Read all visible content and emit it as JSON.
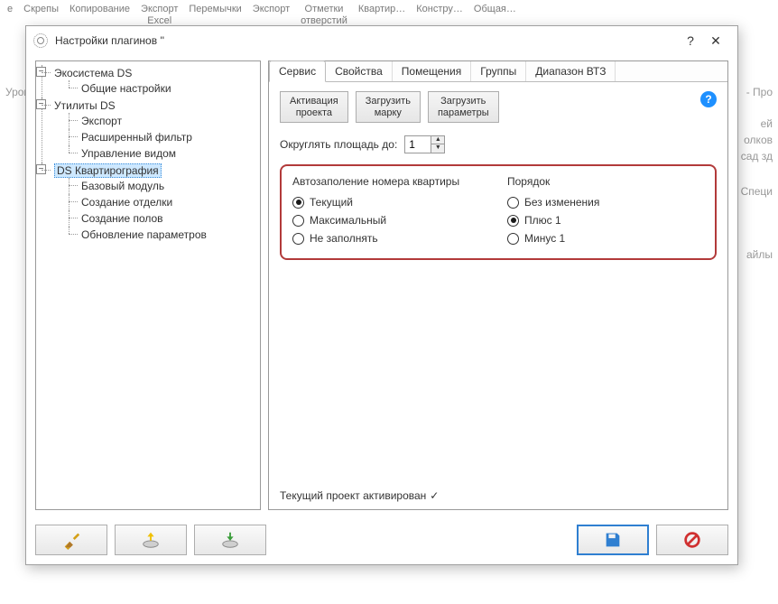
{
  "ribbon": {
    "items": [
      "е",
      "Скрепы",
      "Копирование",
      "Экспорт\nExcel",
      "Перемычки",
      "Экспорт",
      "Отметки\nотверстий",
      "Квартир…",
      "Констру…",
      "Общая…"
    ]
  },
  "bg": {
    "left": "Урове",
    "right_lines": [
      "- Про",
      "ей",
      "олков",
      "сад зд",
      "Специ",
      "айлы"
    ]
  },
  "dialog": {
    "title": "Настройки плагинов ''"
  },
  "tree": {
    "n0": "Экосистема DS",
    "n0_0": "Общие настройки",
    "n1": "Утилиты DS",
    "n1_0": "Экспорт",
    "n1_1": "Расширенный фильтр",
    "n1_2": "Управление видом",
    "n2": "DS Квартирография",
    "n2_0": "Базовый модуль",
    "n2_1": "Создание отделки",
    "n2_2": "Создание полов",
    "n2_3": "Обновление параметров"
  },
  "tabs": {
    "t0": "Сервис",
    "t1": "Свойства",
    "t2": "Помещения",
    "t3": "Группы",
    "t4": "Диапазон ВТЗ"
  },
  "buttons": {
    "activate": "Активация\nпроекта",
    "load_mark": "Загрузить\nмарку",
    "load_params": "Загрузить\nпараметры"
  },
  "round": {
    "label": "Округлять площадь до:",
    "value": "1"
  },
  "group": {
    "auto_title": "Автозаполение номера квартиры",
    "order_title": "Порядок",
    "auto": {
      "current": "Текущий",
      "max": "Максимальный",
      "none": "Не заполнять"
    },
    "order": {
      "keep": "Без изменения",
      "plus1": "Плюс 1",
      "minus1": "Минус 1"
    }
  },
  "status": "Текущий проект  активирован"
}
